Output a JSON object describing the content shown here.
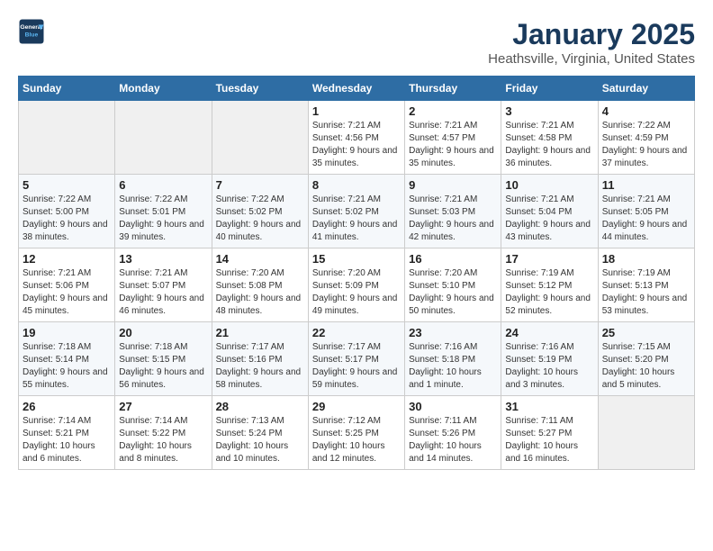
{
  "header": {
    "logo_line1": "General",
    "logo_line2": "Blue",
    "month": "January 2025",
    "location": "Heathsville, Virginia, United States"
  },
  "days_of_week": [
    "Sunday",
    "Monday",
    "Tuesday",
    "Wednesday",
    "Thursday",
    "Friday",
    "Saturday"
  ],
  "weeks": [
    [
      {
        "day": "",
        "info": ""
      },
      {
        "day": "",
        "info": ""
      },
      {
        "day": "",
        "info": ""
      },
      {
        "day": "1",
        "info": "Sunrise: 7:21 AM\nSunset: 4:56 PM\nDaylight: 9 hours and 35 minutes."
      },
      {
        "day": "2",
        "info": "Sunrise: 7:21 AM\nSunset: 4:57 PM\nDaylight: 9 hours and 35 minutes."
      },
      {
        "day": "3",
        "info": "Sunrise: 7:21 AM\nSunset: 4:58 PM\nDaylight: 9 hours and 36 minutes."
      },
      {
        "day": "4",
        "info": "Sunrise: 7:22 AM\nSunset: 4:59 PM\nDaylight: 9 hours and 37 minutes."
      }
    ],
    [
      {
        "day": "5",
        "info": "Sunrise: 7:22 AM\nSunset: 5:00 PM\nDaylight: 9 hours and 38 minutes."
      },
      {
        "day": "6",
        "info": "Sunrise: 7:22 AM\nSunset: 5:01 PM\nDaylight: 9 hours and 39 minutes."
      },
      {
        "day": "7",
        "info": "Sunrise: 7:22 AM\nSunset: 5:02 PM\nDaylight: 9 hours and 40 minutes."
      },
      {
        "day": "8",
        "info": "Sunrise: 7:21 AM\nSunset: 5:02 PM\nDaylight: 9 hours and 41 minutes."
      },
      {
        "day": "9",
        "info": "Sunrise: 7:21 AM\nSunset: 5:03 PM\nDaylight: 9 hours and 42 minutes."
      },
      {
        "day": "10",
        "info": "Sunrise: 7:21 AM\nSunset: 5:04 PM\nDaylight: 9 hours and 43 minutes."
      },
      {
        "day": "11",
        "info": "Sunrise: 7:21 AM\nSunset: 5:05 PM\nDaylight: 9 hours and 44 minutes."
      }
    ],
    [
      {
        "day": "12",
        "info": "Sunrise: 7:21 AM\nSunset: 5:06 PM\nDaylight: 9 hours and 45 minutes."
      },
      {
        "day": "13",
        "info": "Sunrise: 7:21 AM\nSunset: 5:07 PM\nDaylight: 9 hours and 46 minutes."
      },
      {
        "day": "14",
        "info": "Sunrise: 7:20 AM\nSunset: 5:08 PM\nDaylight: 9 hours and 48 minutes."
      },
      {
        "day": "15",
        "info": "Sunrise: 7:20 AM\nSunset: 5:09 PM\nDaylight: 9 hours and 49 minutes."
      },
      {
        "day": "16",
        "info": "Sunrise: 7:20 AM\nSunset: 5:10 PM\nDaylight: 9 hours and 50 minutes."
      },
      {
        "day": "17",
        "info": "Sunrise: 7:19 AM\nSunset: 5:12 PM\nDaylight: 9 hours and 52 minutes."
      },
      {
        "day": "18",
        "info": "Sunrise: 7:19 AM\nSunset: 5:13 PM\nDaylight: 9 hours and 53 minutes."
      }
    ],
    [
      {
        "day": "19",
        "info": "Sunrise: 7:18 AM\nSunset: 5:14 PM\nDaylight: 9 hours and 55 minutes."
      },
      {
        "day": "20",
        "info": "Sunrise: 7:18 AM\nSunset: 5:15 PM\nDaylight: 9 hours and 56 minutes."
      },
      {
        "day": "21",
        "info": "Sunrise: 7:17 AM\nSunset: 5:16 PM\nDaylight: 9 hours and 58 minutes."
      },
      {
        "day": "22",
        "info": "Sunrise: 7:17 AM\nSunset: 5:17 PM\nDaylight: 9 hours and 59 minutes."
      },
      {
        "day": "23",
        "info": "Sunrise: 7:16 AM\nSunset: 5:18 PM\nDaylight: 10 hours and 1 minute."
      },
      {
        "day": "24",
        "info": "Sunrise: 7:16 AM\nSunset: 5:19 PM\nDaylight: 10 hours and 3 minutes."
      },
      {
        "day": "25",
        "info": "Sunrise: 7:15 AM\nSunset: 5:20 PM\nDaylight: 10 hours and 5 minutes."
      }
    ],
    [
      {
        "day": "26",
        "info": "Sunrise: 7:14 AM\nSunset: 5:21 PM\nDaylight: 10 hours and 6 minutes."
      },
      {
        "day": "27",
        "info": "Sunrise: 7:14 AM\nSunset: 5:22 PM\nDaylight: 10 hours and 8 minutes."
      },
      {
        "day": "28",
        "info": "Sunrise: 7:13 AM\nSunset: 5:24 PM\nDaylight: 10 hours and 10 minutes."
      },
      {
        "day": "29",
        "info": "Sunrise: 7:12 AM\nSunset: 5:25 PM\nDaylight: 10 hours and 12 minutes."
      },
      {
        "day": "30",
        "info": "Sunrise: 7:11 AM\nSunset: 5:26 PM\nDaylight: 10 hours and 14 minutes."
      },
      {
        "day": "31",
        "info": "Sunrise: 7:11 AM\nSunset: 5:27 PM\nDaylight: 10 hours and 16 minutes."
      },
      {
        "day": "",
        "info": ""
      }
    ]
  ]
}
